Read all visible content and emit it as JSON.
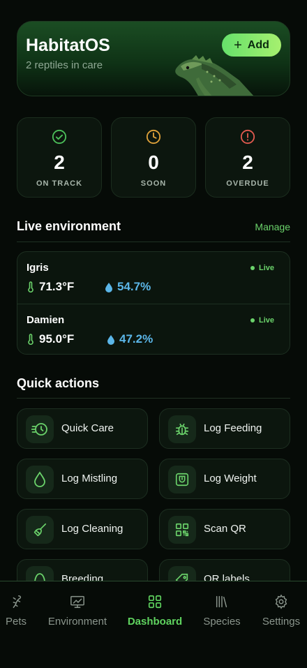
{
  "header": {
    "title": "HabitatOS",
    "subtitle": "2 reptiles in care",
    "add_label": "Add"
  },
  "stats": [
    {
      "value": "2",
      "label": "ON TRACK",
      "icon": "check-circle-icon",
      "color": "#4cc05a"
    },
    {
      "value": "0",
      "label": "SOON",
      "icon": "clock-icon",
      "color": "#e0a23a"
    },
    {
      "value": "2",
      "label": "OVERDUE",
      "icon": "alert-circle-icon",
      "color": "#e25a4f"
    }
  ],
  "environment": {
    "title": "Live environment",
    "manage_label": "Manage",
    "rows": [
      {
        "name": "Igris",
        "status": "Live",
        "temp": "71.3°F",
        "humidity": "54.7%"
      },
      {
        "name": "Damien",
        "status": "Live",
        "temp": "95.0°F",
        "humidity": "47.2%"
      }
    ]
  },
  "quick_actions": {
    "title": "Quick actions",
    "items": [
      {
        "label": "Quick Care",
        "icon": "quick-timer-icon"
      },
      {
        "label": "Log Feeding",
        "icon": "bug-icon"
      },
      {
        "label": "Log Mistling",
        "icon": "droplet-icon"
      },
      {
        "label": "Log Weight",
        "icon": "scale-icon"
      },
      {
        "label": "Log Cleaning",
        "icon": "broom-icon"
      },
      {
        "label": "Scan QR",
        "icon": "qr-code-icon"
      },
      {
        "label": "Breeding",
        "icon": "egg-icon"
      },
      {
        "label": "QR labels",
        "icon": "tag-icon"
      }
    ]
  },
  "tabs": [
    {
      "label": "Pets",
      "icon": "lizard-icon",
      "active": false
    },
    {
      "label": "Environment",
      "icon": "monitor-chart-icon",
      "active": false
    },
    {
      "label": "Dashboard",
      "icon": "grid-icon",
      "active": true
    },
    {
      "label": "Species",
      "icon": "books-icon",
      "active": false
    },
    {
      "label": "Settings",
      "icon": "gear-icon",
      "active": false
    }
  ],
  "colors": {
    "accent": "#5fd35f",
    "background": "#060b07",
    "card": "#0c160e",
    "humidity": "#5bb6e8"
  }
}
